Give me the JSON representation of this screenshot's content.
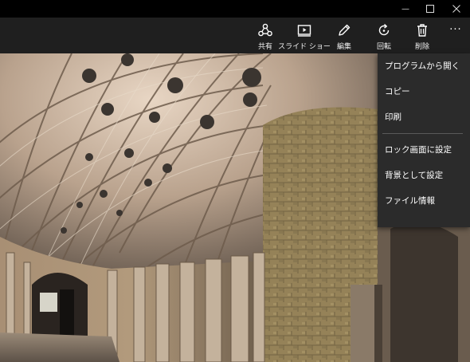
{
  "window": {
    "minimize_glyph": "—",
    "maximize_glyph": "☐",
    "close_glyph": "✕"
  },
  "toolbar": {
    "share_label": "共有",
    "slideshow_label": "スライド ショー",
    "edit_label": "編集",
    "rotate_label": "回転",
    "delete_label": "削除",
    "more_glyph": "···"
  },
  "context_menu": {
    "open_with": "プログラムから開く",
    "copy": "コピー",
    "print": "印刷",
    "set_lock_screen": "ロック画面に設定",
    "set_background": "背景として設定",
    "file_info": "ファイル情報"
  },
  "icons": {
    "share": "share-icon",
    "slideshow": "slideshow-icon",
    "edit": "pencil-icon",
    "rotate": "rotate-icon",
    "delete": "trash-icon",
    "more": "more-icon"
  }
}
